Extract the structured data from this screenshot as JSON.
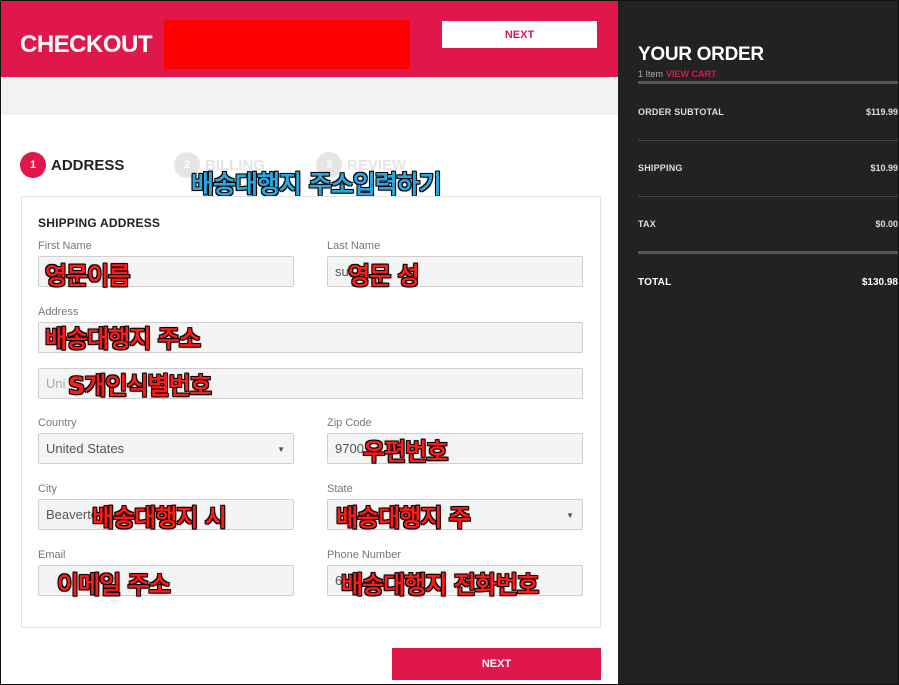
{
  "header": {
    "title": "CHECKOUT",
    "next_label": "NEXT",
    "brand_color": "#e0174b"
  },
  "steps": [
    {
      "num": "1",
      "label": "ADDRESS",
      "active": true
    },
    {
      "num": "2",
      "label": "BILLING",
      "active": false
    },
    {
      "num": "3",
      "label": "REVIEW",
      "active": false
    }
  ],
  "annotations": {
    "heading": "배송대행지 주소입력하기",
    "first_name": "영문이름",
    "last_name": "영문 성",
    "address": "배송대행지 주소",
    "address2": "S개인식별번호",
    "zip": "우편번호",
    "city": "배송대행지 시",
    "state": "배송대행지 주",
    "email": "이메일 주소",
    "phone": "배송대행지 전화번호"
  },
  "form": {
    "section_title": "SHIPPING ADDRESS",
    "first_name_label": "First Name",
    "last_name_label": "Last Name",
    "last_name_value": "su",
    "address_label": "Address",
    "address2_value": "Uni",
    "country_label": "Country",
    "country_value": "United States",
    "zip_label": "Zip Code",
    "zip_value": "9700",
    "city_label": "City",
    "city_value": "Beaverto",
    "state_label": "State",
    "email_label": "Email",
    "phone_label": "Phone Number",
    "phone_value": "6",
    "next_label": "NEXT"
  },
  "order": {
    "title": "YOUR ORDER",
    "item_count": "1 Item",
    "view_cart": "VIEW CART",
    "subtotal_label": "ORDER SUBTOTAL",
    "subtotal_value": "$119.99",
    "shipping_label": "SHIPPING",
    "shipping_value": "$10.99",
    "tax_label": "TAX",
    "tax_value": "$0.00",
    "total_label": "TOTAL",
    "total_value": "$130.98"
  },
  "icons": {
    "dropdown": "chevron-down-icon"
  }
}
